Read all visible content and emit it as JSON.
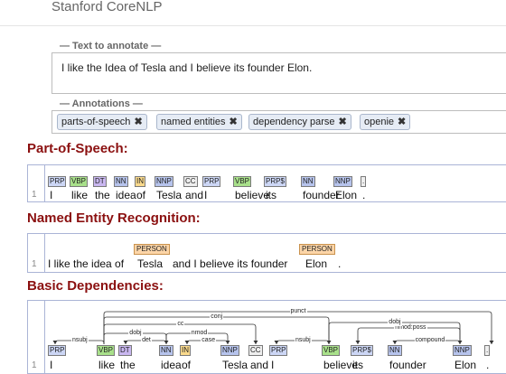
{
  "app": {
    "title": "Stanford CoreNLP"
  },
  "input": {
    "legend": "— Text to annotate —",
    "value": "I like the Idea of Tesla and I believe its founder Elon."
  },
  "annotations": {
    "legend": "— Annotations —",
    "chips": [
      {
        "label": "parts-of-speech",
        "remove": "✖"
      },
      {
        "label": "named entities",
        "remove": "✖"
      },
      {
        "label": "dependency parse",
        "remove": "✖"
      },
      {
        "label": "openie",
        "remove": "✖"
      }
    ]
  },
  "colors": {
    "section_title": "#8b1010",
    "prp": "#ccd6f5",
    "vb": "#a8e08a",
    "dt": "#c9b7f0",
    "nn": "#b6c3ec",
    "in": "#f9d98c",
    "cc": "#eeeeee",
    "ent": "#fcd5a8"
  },
  "pos": {
    "title": "Part-of-Speech:",
    "line": "1",
    "tokens": [
      {
        "word": "I",
        "tag": "PRP"
      },
      {
        "word": "like",
        "tag": "VBP"
      },
      {
        "word": "the",
        "tag": "DT"
      },
      {
        "word": "idea",
        "tag": "NN"
      },
      {
        "word": "of",
        "tag": "IN"
      },
      {
        "word": "Tesla",
        "tag": "NNP"
      },
      {
        "word": "and",
        "tag": "CC"
      },
      {
        "word": "I",
        "tag": "PRP"
      },
      {
        "word": "believe",
        "tag": "VBP"
      },
      {
        "word": "its",
        "tag": "PRP$"
      },
      {
        "word": "founder",
        "tag": "NN"
      },
      {
        "word": "Elon",
        "tag": "NNP"
      },
      {
        "word": ".",
        "tag": "."
      }
    ]
  },
  "ner": {
    "title": "Named Entity Recognition:",
    "line": "1",
    "text_before": "I like the idea of",
    "ent1_word": "Tesla",
    "ent1_label": "PERSON",
    "text_middle": "and I believe its founder",
    "ent2_word": "Elon",
    "ent2_label": "PERSON",
    "text_end": "."
  },
  "deps": {
    "title": "Basic Dependencies:",
    "line": "1",
    "tokens": [
      {
        "word": "I",
        "tag": "PRP"
      },
      {
        "word": "like",
        "tag": "VBP"
      },
      {
        "word": "the",
        "tag": "DT"
      },
      {
        "word": "idea",
        "tag": "NN"
      },
      {
        "word": "of",
        "tag": "IN"
      },
      {
        "word": "Tesla",
        "tag": "NNP"
      },
      {
        "word": "and",
        "tag": "CC"
      },
      {
        "word": "I",
        "tag": "PRP"
      },
      {
        "word": "believe",
        "tag": "VBP"
      },
      {
        "word": "its",
        "tag": "PRP$"
      },
      {
        "word": "founder",
        "tag": "NN"
      },
      {
        "word": "Elon",
        "tag": "NNP"
      },
      {
        "word": ".",
        "tag": "."
      }
    ],
    "arcs": [
      {
        "label": "nsubj"
      },
      {
        "label": "det"
      },
      {
        "label": "dobj"
      },
      {
        "label": "case"
      },
      {
        "label": "nmod"
      },
      {
        "label": "cc"
      },
      {
        "label": "conj"
      },
      {
        "label": "nsubj"
      },
      {
        "label": "nmod:poss"
      },
      {
        "label": "compound"
      },
      {
        "label": "dobj"
      },
      {
        "label": "punct"
      }
    ]
  }
}
